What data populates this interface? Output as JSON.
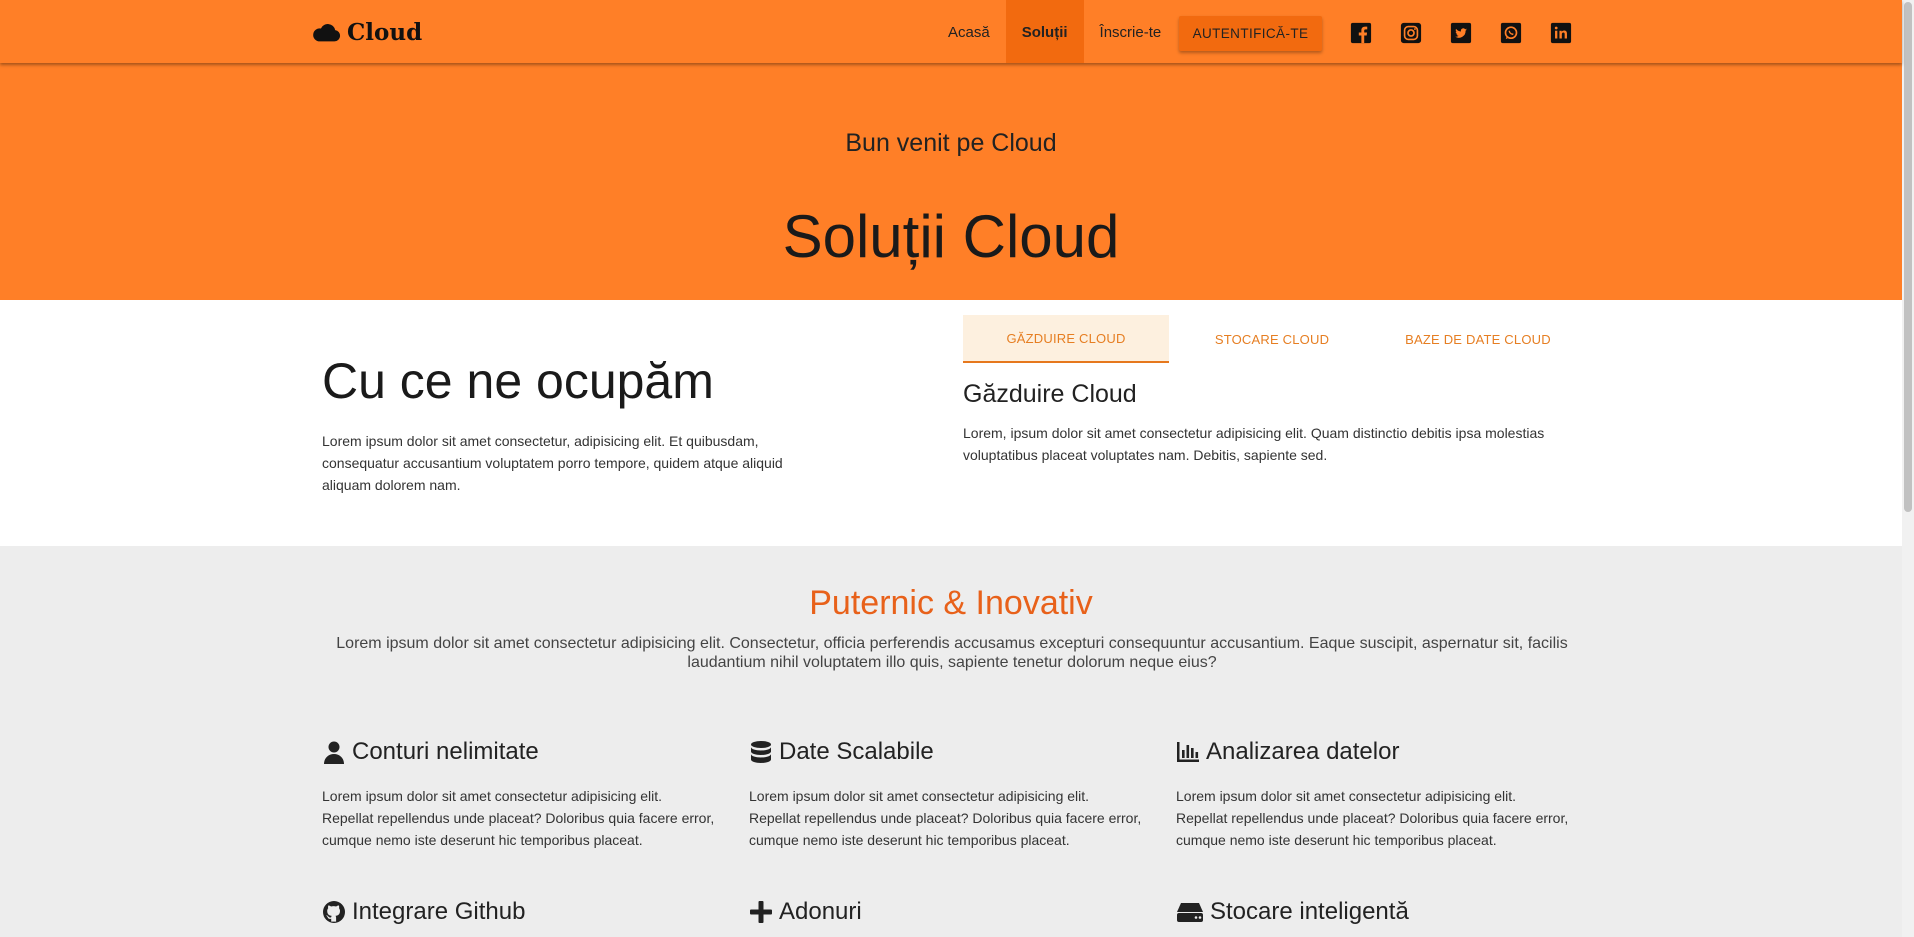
{
  "navbar": {
    "brand": "Cloud",
    "links": [
      "Acasă",
      "Soluții",
      "Înscrie-te"
    ],
    "login": "AUTENTIFICĂ-TE",
    "socials": [
      "facebook-icon",
      "instagram-icon",
      "twitter-icon",
      "whatsapp-icon",
      "linkedin-icon"
    ]
  },
  "hero": {
    "subtitle": "Bun venit pe Cloud",
    "title": "Soluții Cloud"
  },
  "about": {
    "title": "Cu ce ne ocupăm",
    "text": "Lorem ipsum dolor sit amet consectetur, adipisicing elit. Et quibusdam, consequatur accusantium voluptatem porro tempore, quidem atque aliquid aliquam dolorem nam.",
    "tabs": [
      "GĂZDUIRE CLOUD",
      "STOCARE CLOUD",
      "BAZE DE DATE CLOUD"
    ],
    "active_tab_heading": "Găzduire Cloud",
    "active_tab_text": "Lorem, ipsum dolor sit amet consectetur adipisicing elit. Quam distinctio debitis ipsa molestias voluptatibus placeat voluptates nam. Debitis, sapiente sed."
  },
  "features": {
    "heading": "Puternic & Inovativ",
    "lead": "Lorem ipsum dolor sit amet consectetur adipisicing elit. Consectetur, officia perferendis accusamus excepturi consequuntur accusantium. Eaque suscipit, aspernatur sit, facilis laudantium nihil voluptatem illo quis, sapiente tenetur dolorum neque eius?",
    "cards": [
      {
        "icon": "user-icon",
        "title": "Conturi nelimitate",
        "text": "Lorem ipsum dolor sit amet consectetur adipisicing elit. Repellat repellendus unde placeat? Doloribus quia facere error, cumque nemo iste deserunt hic temporibus placeat."
      },
      {
        "icon": "database-icon",
        "title": "Date Scalabile",
        "text": "Lorem ipsum dolor sit amet consectetur adipisicing elit. Repellat repellendus unde placeat? Doloribus quia facere error, cumque nemo iste deserunt hic temporibus placeat."
      },
      {
        "icon": "chart-bar-icon",
        "title": "Analizarea datelor",
        "text": "Lorem ipsum dolor sit amet consectetur adipisicing elit. Repellat repellendus unde placeat? Doloribus quia facere error, cumque nemo iste deserunt hic temporibus placeat."
      },
      {
        "icon": "github-icon",
        "title": "Integrare Github",
        "text": ""
      },
      {
        "icon": "plus-icon",
        "title": "Adonuri",
        "text": ""
      },
      {
        "icon": "hdd-icon",
        "title": "Stocare inteligentă",
        "text": ""
      }
    ]
  },
  "colors": {
    "brand_orange": "#ff7f27",
    "active_orange": "#f26a0f",
    "heading_orange": "#e8611a"
  }
}
